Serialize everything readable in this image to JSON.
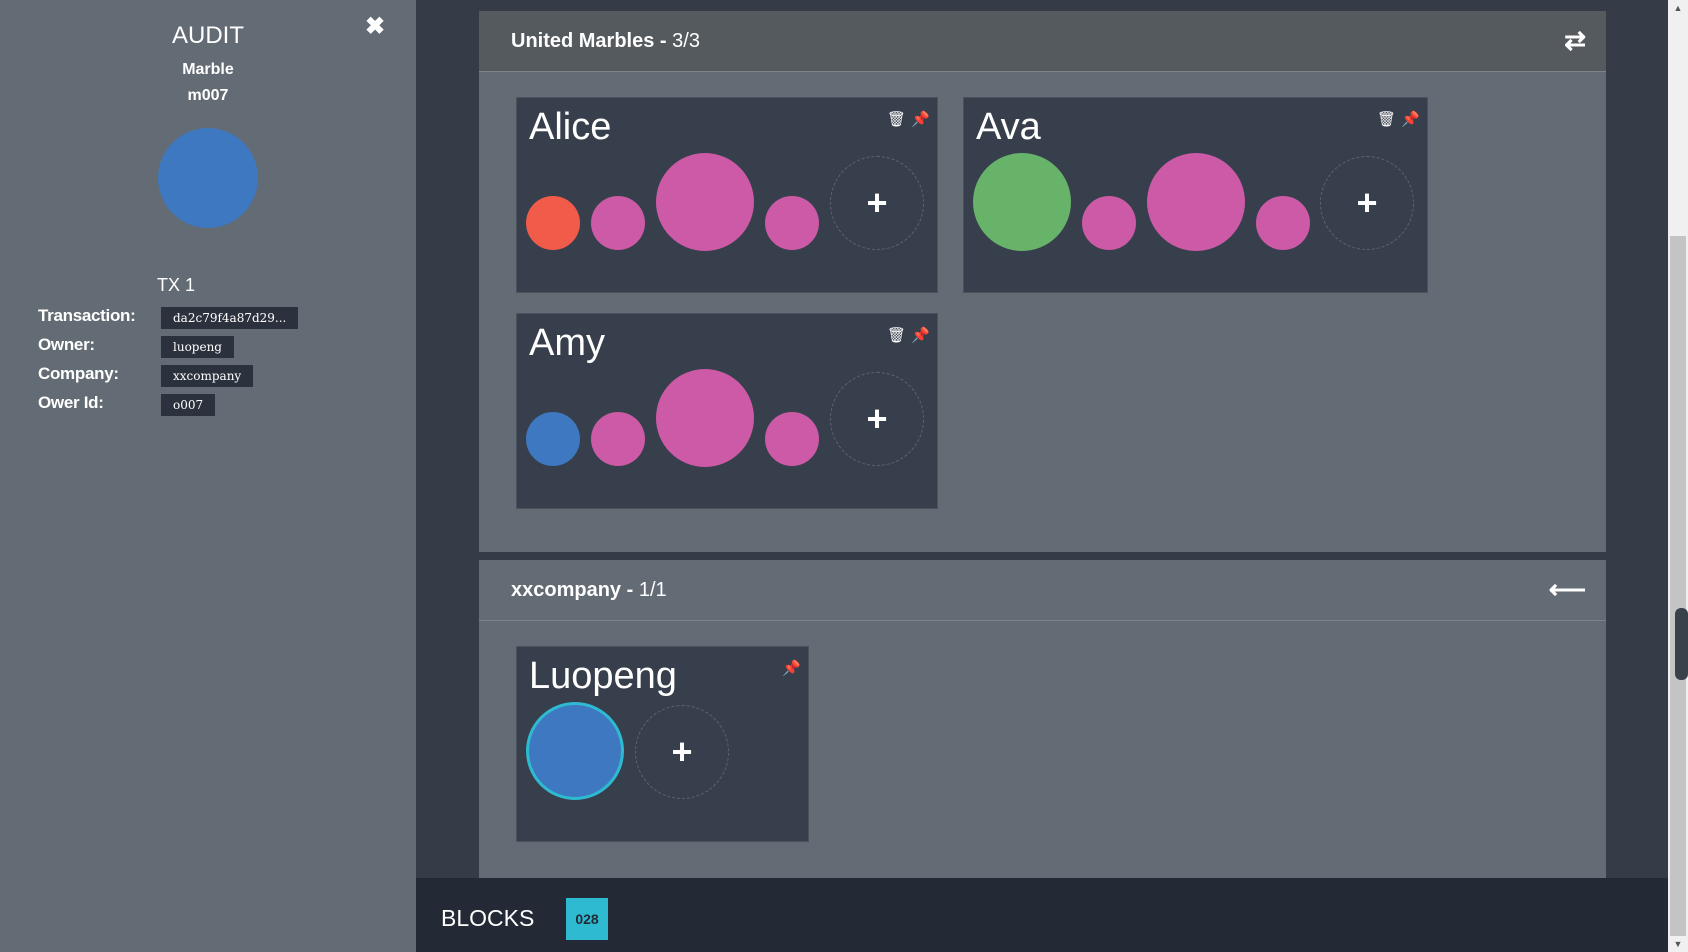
{
  "audit": {
    "title": "AUDIT",
    "close_icon": "close-icon",
    "marble_label": "Marble",
    "marble_id": "m007",
    "marble_color": "#3e78c0",
    "tx_title": "TX 1",
    "fields": [
      {
        "label": "Transaction:",
        "value": "da2c79f4a87d29..."
      },
      {
        "label": "Owner:",
        "value": "luopeng"
      },
      {
        "label": "Company:",
        "value": "xxcompany"
      },
      {
        "label": "Ower Id:",
        "value": "o007"
      }
    ]
  },
  "companies": [
    {
      "name": "United Marbles -",
      "count": "3/3",
      "icon": "transfer-icon",
      "users": [
        {
          "name": "Alice",
          "marbles": [
            "#f15b4a",
            "#cc5aa6",
            "#cc5aa6",
            "#cc5aa6"
          ]
        },
        {
          "name": "Ava",
          "marbles": [
            "#67b36a",
            "#cc5aa6",
            "#cc5aa6",
            "#cc5aa6"
          ]
        },
        {
          "name": "Amy",
          "marbles": [
            "#3e78c0",
            "#cc5aa6",
            "#cc5aa6",
            "#cc5aa6"
          ]
        }
      ]
    },
    {
      "name": "xxcompany -",
      "count": "1/1",
      "icon": "arrow-left-icon",
      "users": [
        {
          "name": "Luopeng",
          "marbles": [
            "#3e78c0"
          ]
        }
      ]
    }
  ],
  "blocks": {
    "label": "BLOCKS",
    "count": "028"
  },
  "icons": {
    "delete": "trash-icon",
    "pin": "pin-icon",
    "add": "+"
  }
}
